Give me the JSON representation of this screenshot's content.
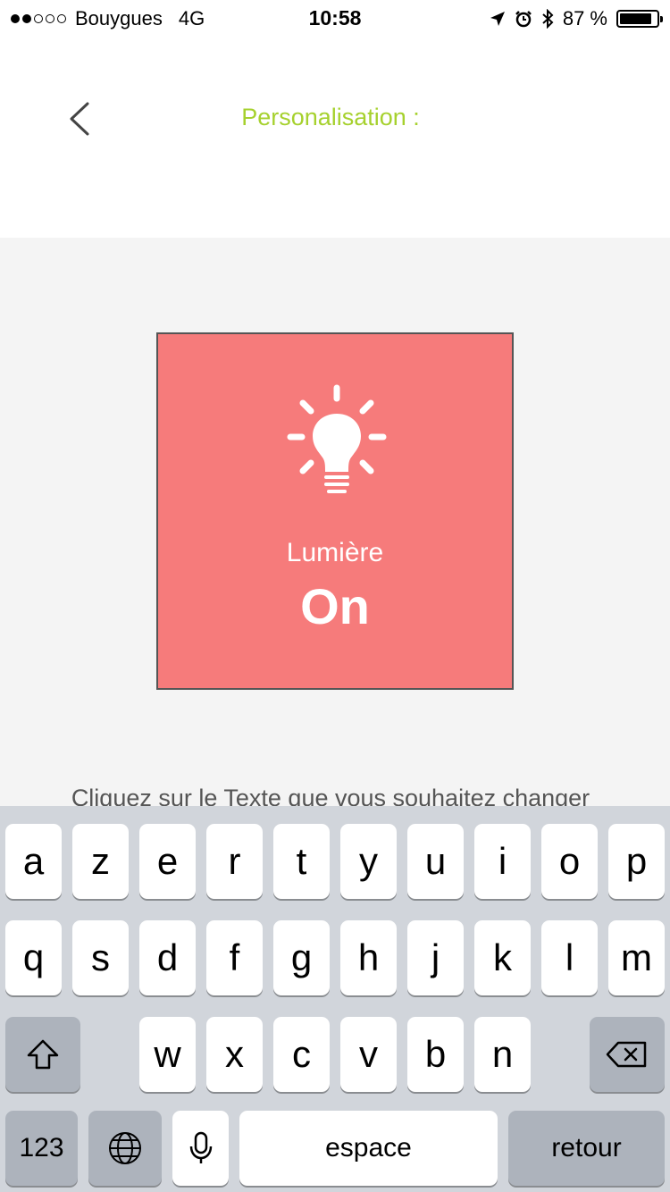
{
  "status_bar": {
    "carrier": "Bouygues",
    "network": "4G",
    "time": "10:58",
    "battery": "87 %",
    "battery_level": 0.87,
    "icons": [
      "location-arrow-icon",
      "alarm-icon",
      "bluetooth-icon",
      "battery-icon"
    ]
  },
  "header": {
    "title": "Personalisation :",
    "title_color": "#a6d12e",
    "back_icon": "chevron-left-icon"
  },
  "tile": {
    "icon": "lightbulb-icon",
    "label": "Lumière",
    "state": "On",
    "color": "#f67b7b"
  },
  "hint": "Cliquez sur le Texte que vous souhaitez changer",
  "keyboard": {
    "row1": [
      "a",
      "z",
      "e",
      "r",
      "t",
      "y",
      "u",
      "i",
      "o",
      "p"
    ],
    "row2": [
      "q",
      "s",
      "d",
      "f",
      "g",
      "h",
      "j",
      "k",
      "l",
      "m"
    ],
    "row3": [
      "w",
      "x",
      "c",
      "v",
      "b",
      "n"
    ],
    "numbers_key": "123",
    "space_key": "espace",
    "return_key": "retour",
    "icons": [
      "shift-icon",
      "backspace-icon",
      "globe-icon",
      "microphone-icon"
    ]
  }
}
